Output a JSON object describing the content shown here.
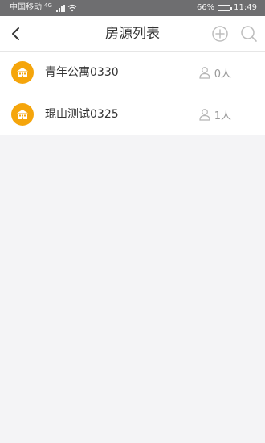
{
  "status_bar": {
    "carrier": "中国移动",
    "network": "4G",
    "battery": "66%",
    "time": "11:49"
  },
  "nav": {
    "title": "房源列表"
  },
  "properties": [
    {
      "name": "青年公寓0330",
      "occupants": "0人"
    },
    {
      "name": "琨山测试0325",
      "occupants": "1人"
    }
  ],
  "colors": {
    "accent": "#f5a50b",
    "status_bar": "#6e6e70",
    "background": "#f4f4f6"
  }
}
